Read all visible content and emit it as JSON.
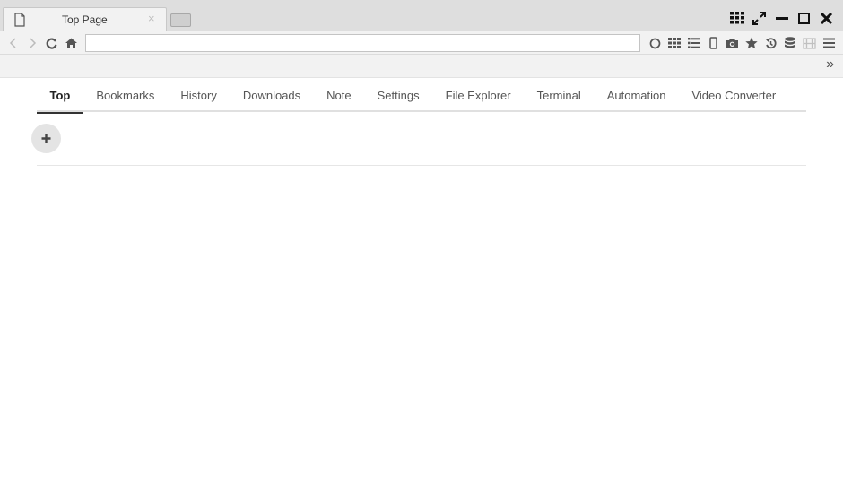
{
  "window": {
    "tab_title": "Top Page",
    "tab_close": "×",
    "controls": [
      "apps-grid-icon",
      "fullscreen-icon",
      "minimize-icon",
      "maximize-icon",
      "close-icon"
    ]
  },
  "navbar": {
    "url_value": "",
    "url_placeholder": "",
    "buttons": [
      "back",
      "forward",
      "reload",
      "home"
    ],
    "tools": [
      "circle",
      "grid",
      "list",
      "mobile",
      "camera",
      "star",
      "history",
      "database",
      "film",
      "menu"
    ]
  },
  "bookmarkbar": {
    "more_label": "»"
  },
  "content": {
    "tabs": [
      {
        "label": "Top",
        "active": true
      },
      {
        "label": "Bookmarks",
        "active": false
      },
      {
        "label": "History",
        "active": false
      },
      {
        "label": "Downloads",
        "active": false
      },
      {
        "label": "Note",
        "active": false
      },
      {
        "label": "Settings",
        "active": false
      },
      {
        "label": "File Explorer",
        "active": false
      },
      {
        "label": "Terminal",
        "active": false
      },
      {
        "label": "Automation",
        "active": false
      },
      {
        "label": "Video Converter",
        "active": false
      }
    ],
    "add_label": "+"
  },
  "colors": {
    "titlebar": "#dedede",
    "toolbar": "#f2f2f2",
    "icon": "#555555",
    "icon_disabled": "#c0c0c0",
    "active_tab_underline": "#333333"
  }
}
